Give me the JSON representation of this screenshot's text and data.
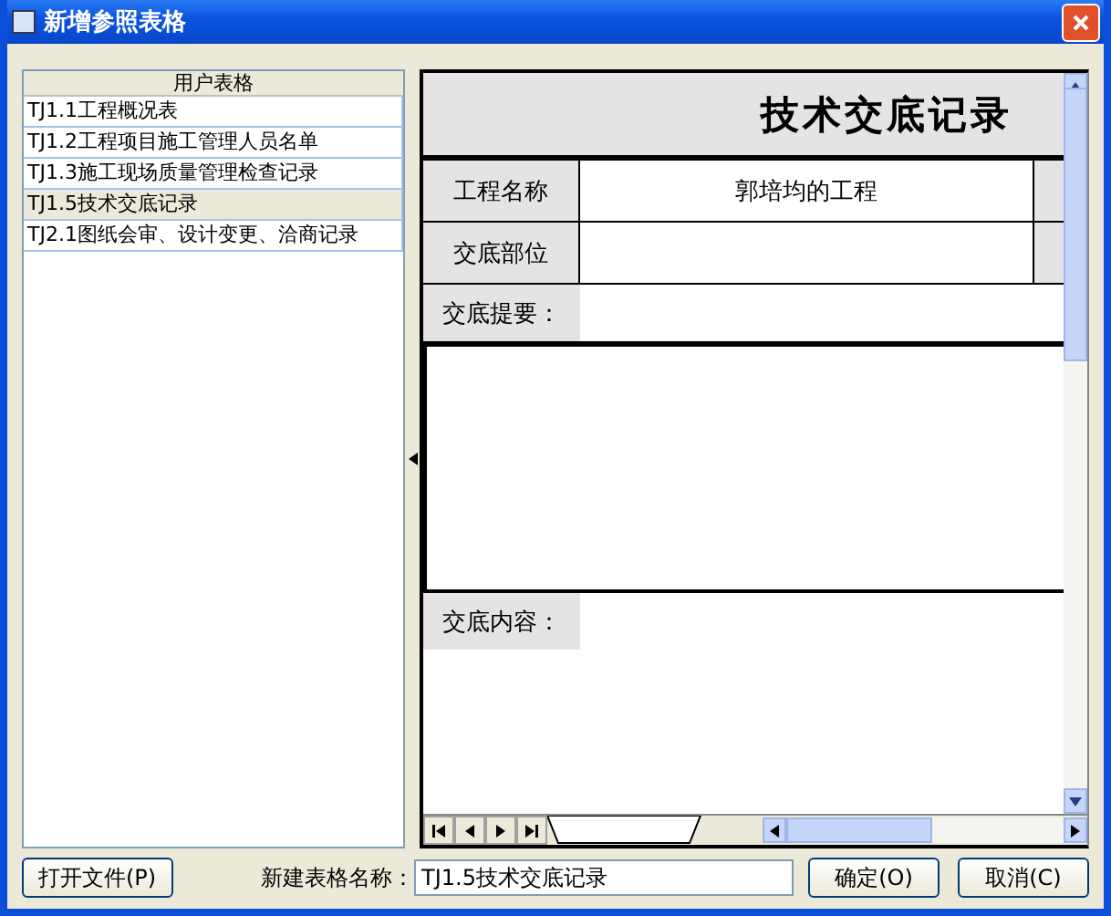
{
  "window": {
    "title": "新增参照表格"
  },
  "list": {
    "header": "用户表格",
    "items": [
      {
        "label": "TJ1.1工程概况表",
        "selected": false
      },
      {
        "label": "TJ1.2工程项目施工管理人员名单",
        "selected": false
      },
      {
        "label": "TJ1.3施工现场质量管理检查记录",
        "selected": false
      },
      {
        "label": "TJ1.5技术交底记录",
        "selected": true
      },
      {
        "label": "TJ2.1图纸会审、设计变更、洽商记录",
        "selected": false
      }
    ]
  },
  "sheet": {
    "title": "技术交底记录",
    "rows": [
      {
        "label": "工程名称",
        "value": "郭培均的工程"
      },
      {
        "label": "交底部位"
      }
    ],
    "summary_label": "交底提要：",
    "content_label": "交底内容："
  },
  "footer": {
    "open_button": "打开文件(P)",
    "name_label": "新建表格名称：",
    "name_value": "TJ1.5技术交底记录",
    "ok_button": "确定(O)",
    "cancel_button": "取消(C)"
  }
}
